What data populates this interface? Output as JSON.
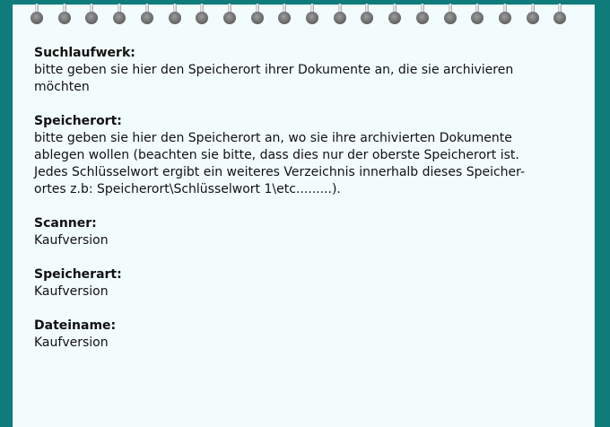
{
  "sections": [
    {
      "heading": "Suchlaufwerk:",
      "text": "bitte geben sie hier den Speicherort ihrer Dokumente an, die sie archivieren\nmöchten"
    },
    {
      "heading": "Speicherort:",
      "text": "bitte geben sie hier den Speicherort an, wo sie ihre archivierten Dokumente\nablegen wollen (beachten sie bitte, dass dies nur der oberste Speicherort ist.\nJedes Schlüsselwort ergibt ein weiteres Verzeichnis innerhalb dieses Speicher-\nortes z.b: Speicherort\\Schlüsselwort 1\\etc.........)."
    },
    {
      "heading": "Scanner:",
      "text": "Kaufversion"
    },
    {
      "heading": "Speicherart:",
      "text": "Kaufversion"
    },
    {
      "heading": "Dateiname:",
      "text": "Kaufversion"
    }
  ],
  "colors": {
    "background": "#0f7b7b",
    "paper": "#f2fcfc",
    "text": "#111111"
  }
}
